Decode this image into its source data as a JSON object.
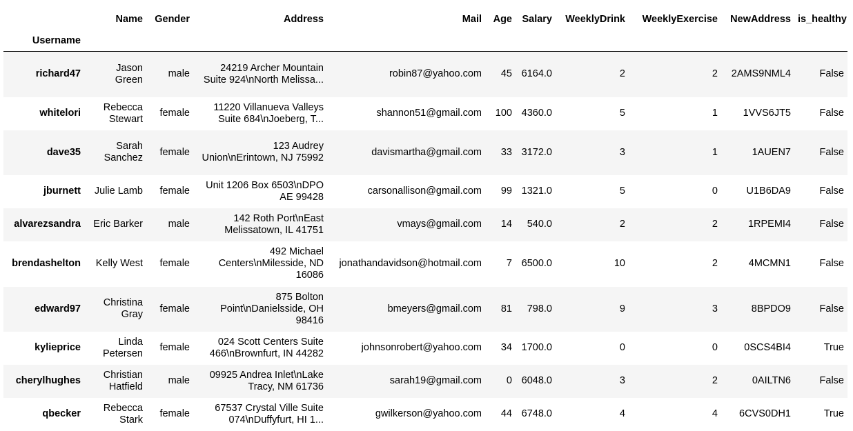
{
  "table": {
    "columns": [
      "Name",
      "Gender",
      "Address",
      "Mail",
      "Age",
      "Salary",
      "WeeklyDrink",
      "WeeklyExercise",
      "NewAddress",
      "is_healthy"
    ],
    "index_name": "Username",
    "rows": [
      {
        "index": "richard47",
        "cells": [
          "Jason Green",
          "male",
          "24219 Archer Mountain Suite 924\\nNorth Melissa...",
          "robin87@yahoo.com",
          "45",
          "6164.0",
          "2",
          "2",
          "2AMS9NML4",
          "False"
        ]
      },
      {
        "index": "whitelori",
        "cells": [
          "Rebecca Stewart",
          "female",
          "11220 Villanueva Valleys Suite 684\\nJoeberg, T...",
          "shannon51@gmail.com",
          "100",
          "4360.0",
          "5",
          "1",
          "1VVS6JT5",
          "False"
        ]
      },
      {
        "index": "dave35",
        "cells": [
          "Sarah Sanchez",
          "female",
          "123 Audrey Union\\nErintown, NJ 75992",
          "davismartha@gmail.com",
          "33",
          "3172.0",
          "3",
          "1",
          "1AUEN7",
          "False"
        ]
      },
      {
        "index": "jburnett",
        "cells": [
          "Julie Lamb",
          "female",
          "Unit 1206 Box 6503\\nDPO AE 99428",
          "carsonallison@gmail.com",
          "99",
          "1321.0",
          "5",
          "0",
          "U1B6DA9",
          "False"
        ]
      },
      {
        "index": "alvarezsandra",
        "cells": [
          "Eric Barker",
          "male",
          "142 Roth Port\\nEast Melissatown, IL 41751",
          "vmays@gmail.com",
          "14",
          "540.0",
          "2",
          "2",
          "1RPEMI4",
          "False"
        ]
      },
      {
        "index": "brendashelton",
        "cells": [
          "Kelly West",
          "female",
          "492 Michael Centers\\nMilesside, ND 16086",
          "jonathandavidson@hotmail.com",
          "7",
          "6500.0",
          "10",
          "2",
          "4MCMN1",
          "False"
        ]
      },
      {
        "index": "edward97",
        "cells": [
          "Christina Gray",
          "female",
          "875 Bolton Point\\nDanielsside, OH 98416",
          "bmeyers@gmail.com",
          "81",
          "798.0",
          "9",
          "3",
          "8BPDO9",
          "False"
        ]
      },
      {
        "index": "kylieprice",
        "cells": [
          "Linda Petersen",
          "female",
          "024 Scott Centers Suite 466\\nBrownfurt, IN 44282",
          "johnsonrobert@yahoo.com",
          "34",
          "1700.0",
          "0",
          "0",
          "0SCS4BI4",
          "True"
        ]
      },
      {
        "index": "cherylhughes",
        "cells": [
          "Christian Hatfield",
          "male",
          "09925 Andrea Inlet\\nLake Tracy, NM 61736",
          "sarah19@gmail.com",
          "0",
          "6048.0",
          "3",
          "2",
          "0AILTN6",
          "False"
        ]
      },
      {
        "index": "qbecker",
        "cells": [
          "Rebecca Stark",
          "female",
          "67537 Crystal Ville Suite 074\\nDuffyfurt, HI 1...",
          "gwilkerson@yahoo.com",
          "44",
          "6748.0",
          "4",
          "4",
          "6CVS0DH1",
          "True"
        ]
      }
    ]
  }
}
